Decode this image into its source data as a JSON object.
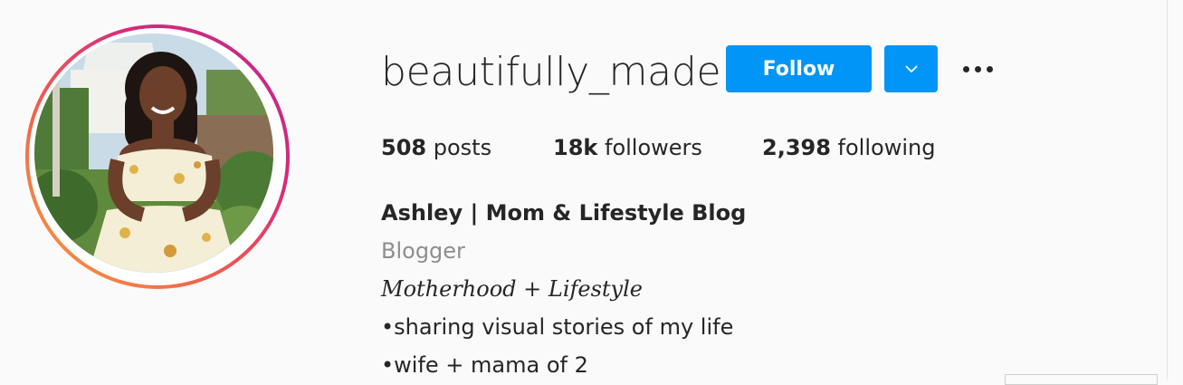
{
  "profile": {
    "username": "beautifully_made",
    "follow_label": "Follow",
    "dropdown_icon": "chevron-down-icon",
    "more_icon": "more-options-icon"
  },
  "stats": {
    "posts_count": "508",
    "posts_label": " posts",
    "followers_count": "18k",
    "followers_label": " followers",
    "following_count": "2,398",
    "following_label": " following"
  },
  "bio": {
    "full_name": "Ashley | Mom & Lifestyle Blog",
    "category": "Blogger",
    "tagline": "Motherhood + Lifestyle",
    "lines": [
      "•sharing visual stories of my life",
      "•wife + mama of 2"
    ]
  },
  "colors": {
    "follow_bg": "#0095f6",
    "text": "#262626",
    "muted": "#8e8e8e",
    "background": "#fafafa"
  }
}
